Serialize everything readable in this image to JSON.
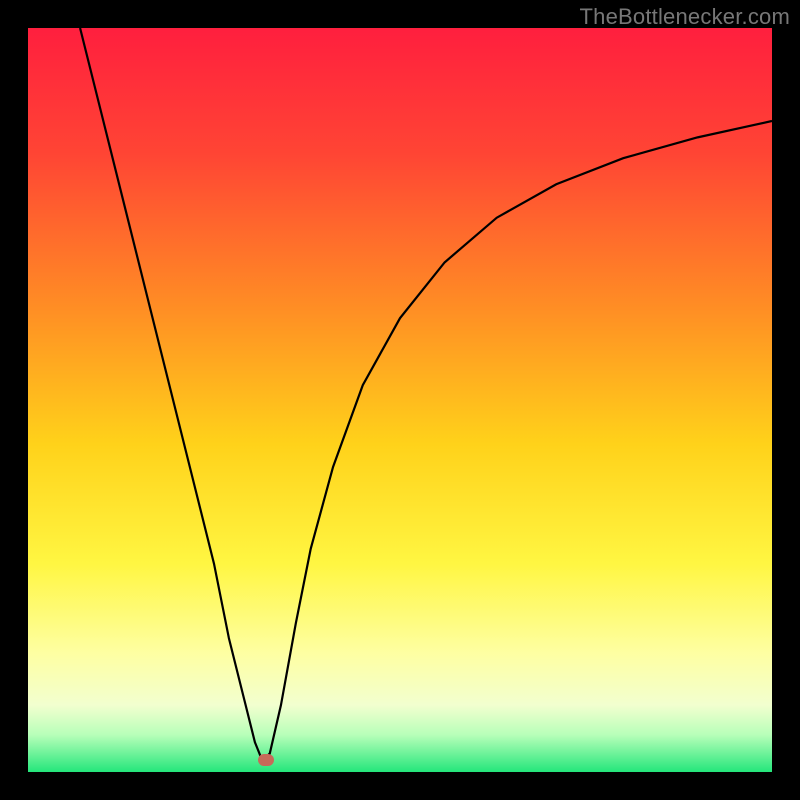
{
  "watermark": "TheBottlenecker.com",
  "chart_data": {
    "type": "line",
    "title": "",
    "xlabel": "",
    "ylabel": "",
    "xlim": [
      0,
      100
    ],
    "ylim": [
      0,
      100
    ],
    "gradient_stops": [
      {
        "offset": 0,
        "color": "#ff1f3e"
      },
      {
        "offset": 17,
        "color": "#ff4534"
      },
      {
        "offset": 38,
        "color": "#ff8f24"
      },
      {
        "offset": 56,
        "color": "#ffd21a"
      },
      {
        "offset": 72,
        "color": "#fff642"
      },
      {
        "offset": 84,
        "color": "#feffa2"
      },
      {
        "offset": 91,
        "color": "#f2ffcf"
      },
      {
        "offset": 95,
        "color": "#b8ffb9"
      },
      {
        "offset": 100,
        "color": "#24e67b"
      }
    ],
    "series": [
      {
        "name": "curve",
        "x": [
          7,
          10,
          13,
          16,
          19,
          22,
          25,
          27,
          29,
          30.5,
          31.5,
          32.5,
          34,
          36,
          38,
          41,
          45,
          50,
          56,
          63,
          71,
          80,
          90,
          100
        ],
        "y": [
          100,
          88,
          76,
          64,
          52,
          40,
          28,
          18,
          10,
          4,
          1.5,
          2.5,
          9,
          20,
          30,
          41,
          52,
          61,
          68.5,
          74.5,
          79,
          82.5,
          85.3,
          87.5
        ]
      }
    ],
    "marker": {
      "x": 32,
      "y": 1.6,
      "color": "#c76a59"
    }
  }
}
